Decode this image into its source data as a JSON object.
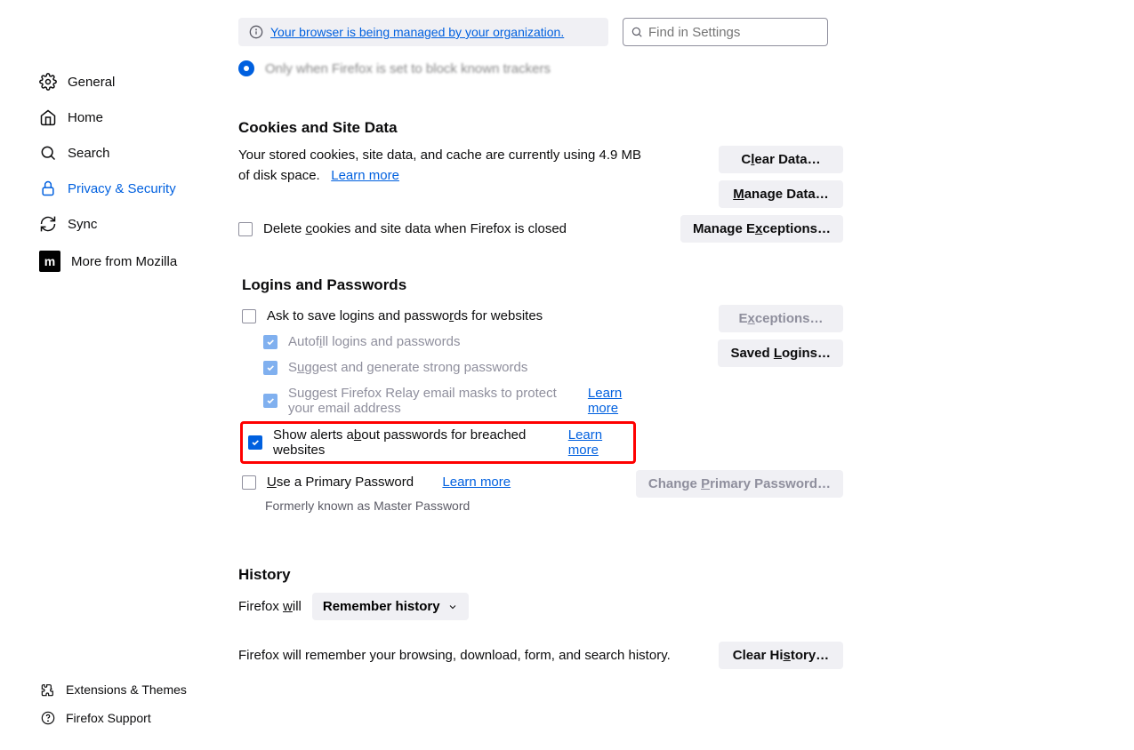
{
  "banner": {
    "text": "Your browser is being managed by your organization."
  },
  "search": {
    "placeholder": "Find in Settings"
  },
  "sidebar": {
    "items": [
      {
        "label": "General"
      },
      {
        "label": "Home"
      },
      {
        "label": "Search"
      },
      {
        "label": "Privacy & Security"
      },
      {
        "label": "Sync"
      },
      {
        "label": "More from Mozilla"
      }
    ],
    "bottom": [
      {
        "label": "Extensions & Themes"
      },
      {
        "label": "Firefox Support"
      }
    ]
  },
  "cutoff": {
    "text": "Only when Firefox is set to block known trackers"
  },
  "cookies": {
    "heading": "Cookies and Site Data",
    "desc_prefix": "Your stored cookies, site data, and cache are currently using ",
    "size": "4.9 MB",
    "desc_suffix": " of disk space.",
    "learn": "Learn more",
    "delete_label": "Delete cookies and site data when Firefox is closed",
    "buttons": {
      "clear": "Clear Data…",
      "manage": "Manage Data…",
      "exceptions": "Manage Exceptions…"
    }
  },
  "logins": {
    "heading": "Logins and Passwords",
    "ask": "Ask to save logins and passwords for websites",
    "autofill": "Autofill logins and passwords",
    "suggest": "Suggest and generate strong passwords",
    "relay": "Suggest Firefox Relay email masks to protect your email address",
    "relay_learn": "Learn more",
    "breach": "Show alerts about passwords for breached websites",
    "breach_learn": "Learn more",
    "primary": "Use a Primary Password",
    "primary_learn": "Learn more",
    "formerly": "Formerly known as Master Password",
    "buttons": {
      "exceptions": "Exceptions…",
      "saved": "Saved Logins…",
      "change": "Change Primary Password…"
    }
  },
  "history": {
    "heading": "History",
    "label": "Firefox will",
    "mode": "Remember history",
    "desc": "Firefox will remember your browsing, download, form, and search history.",
    "clear": "Clear History…"
  }
}
